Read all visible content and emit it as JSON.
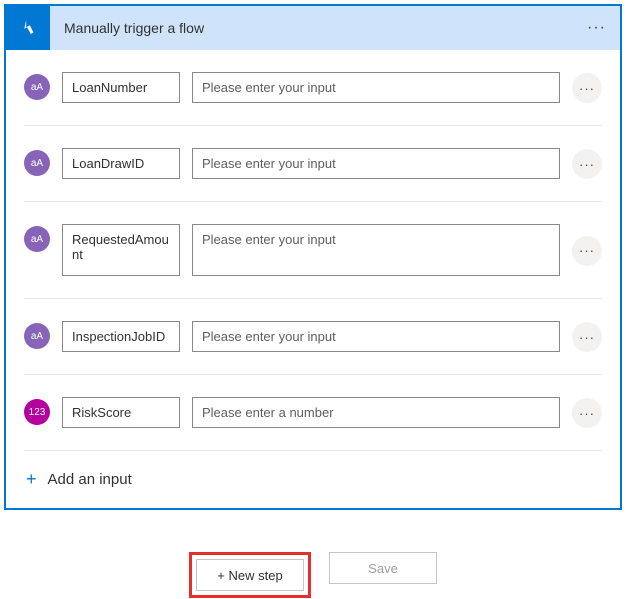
{
  "header": {
    "title": "Manually trigger a flow"
  },
  "inputs": [
    {
      "type": "text",
      "name": "LoanNumber",
      "placeholder": "Please enter your input"
    },
    {
      "type": "text",
      "name": "LoanDrawID",
      "placeholder": "Please enter your input"
    },
    {
      "type": "text",
      "name": "RequestedAmount",
      "placeholder": "Please enter your input",
      "tall": true
    },
    {
      "type": "text",
      "name": "InspectionJobID",
      "placeholder": "Please enter your input"
    },
    {
      "type": "number",
      "name": "RiskScore",
      "placeholder": "Please enter a number"
    }
  ],
  "addInput": {
    "label": "Add an input"
  },
  "footer": {
    "newStep": "+ New step",
    "save": "Save"
  },
  "icons": {
    "textGlyph": "aA",
    "numberGlyph": "123"
  }
}
